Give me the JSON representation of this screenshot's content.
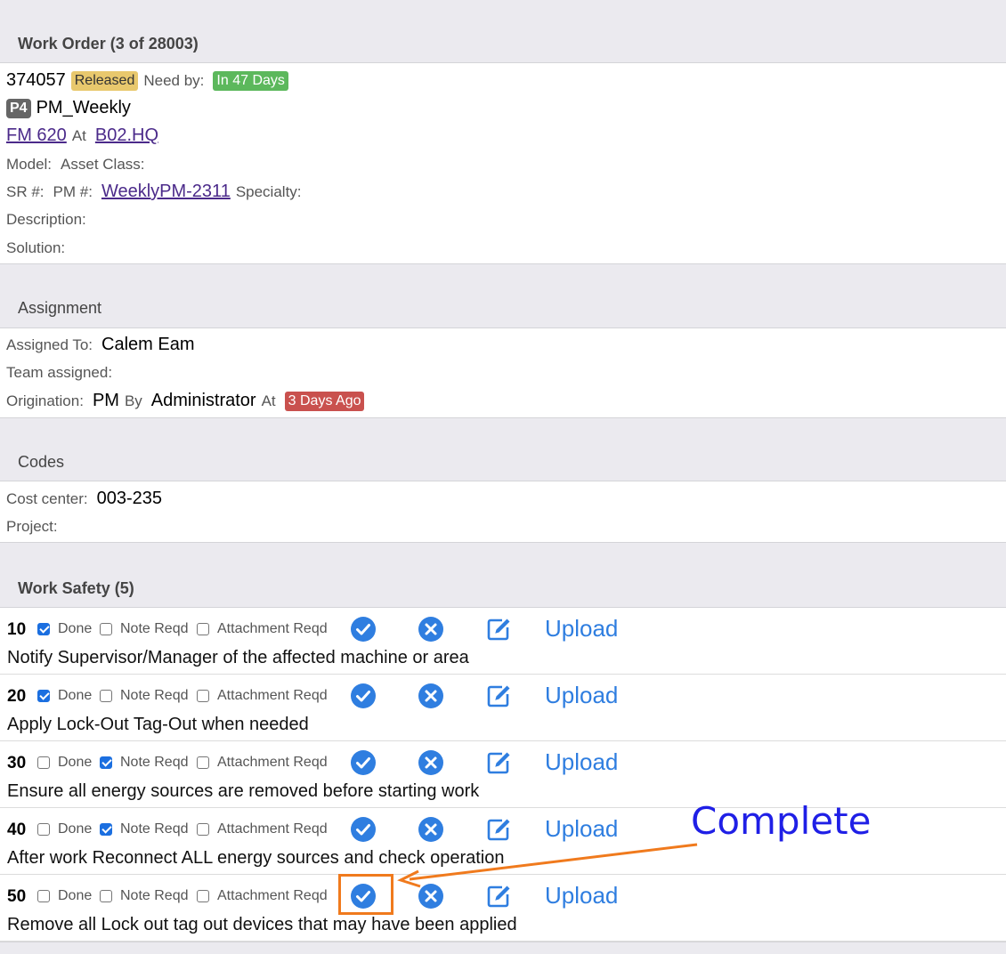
{
  "work_order": {
    "title": "Work Order (3 of 28003)",
    "number": "374057",
    "status": "Released",
    "need_by_label": "Need by:",
    "need_by": "In 47 Days",
    "priority": "P4",
    "name": "PM_Weekly",
    "asset": "FM 620",
    "at_label": "At",
    "location": "B02.HQ",
    "model_label": "Model:",
    "asset_class_label": "Asset Class:",
    "sr_label": "SR #:",
    "pm_label": "PM #:",
    "pm": "WeeklyPM-2311",
    "specialty_label": "Specialty:",
    "description_label": "Description:",
    "solution_label": "Solution:"
  },
  "assignment": {
    "title": "Assignment",
    "assigned_to_label": "Assigned To:",
    "assigned_to": "Calem Eam",
    "team_label": "Team assigned:",
    "origination_label": "Origination:",
    "origination": "PM",
    "by_label": "By",
    "by": "Administrator",
    "at_label": "At",
    "at": "3 Days Ago"
  },
  "codes": {
    "title": "Codes",
    "cost_center_label": "Cost center:",
    "cost_center": "003-235",
    "project_label": "Project:"
  },
  "safety": {
    "title": "Work Safety (5)",
    "done_label": "Done",
    "note_label": "Note Reqd",
    "attach_label": "Attachment Reqd",
    "upload_label": "Upload",
    "items": [
      {
        "seq": "10",
        "done": true,
        "note": false,
        "attach": false,
        "text": "Notify Supervisor/Manager of the affected machine or area"
      },
      {
        "seq": "20",
        "done": true,
        "note": false,
        "attach": false,
        "text": "Apply Lock-Out Tag-Out when needed"
      },
      {
        "seq": "30",
        "done": false,
        "note": true,
        "attach": false,
        "text": "Ensure all energy sources are removed before starting work"
      },
      {
        "seq": "40",
        "done": false,
        "note": true,
        "attach": false,
        "text": "After work Reconnect ALL energy sources and check operation"
      },
      {
        "seq": "50",
        "done": false,
        "note": false,
        "attach": false,
        "text": "Remove all Lock out tag out devices that may have been applied"
      }
    ]
  },
  "annotation": {
    "text": "Complete",
    "color": "#1f1fe6",
    "highlight_color": "#f07a1d"
  },
  "colors": {
    "accent": "#2f7ee0",
    "released": "#e8c86d",
    "success": "#5cb85c",
    "danger": "#c9514e",
    "link": "#4b2a8a"
  }
}
